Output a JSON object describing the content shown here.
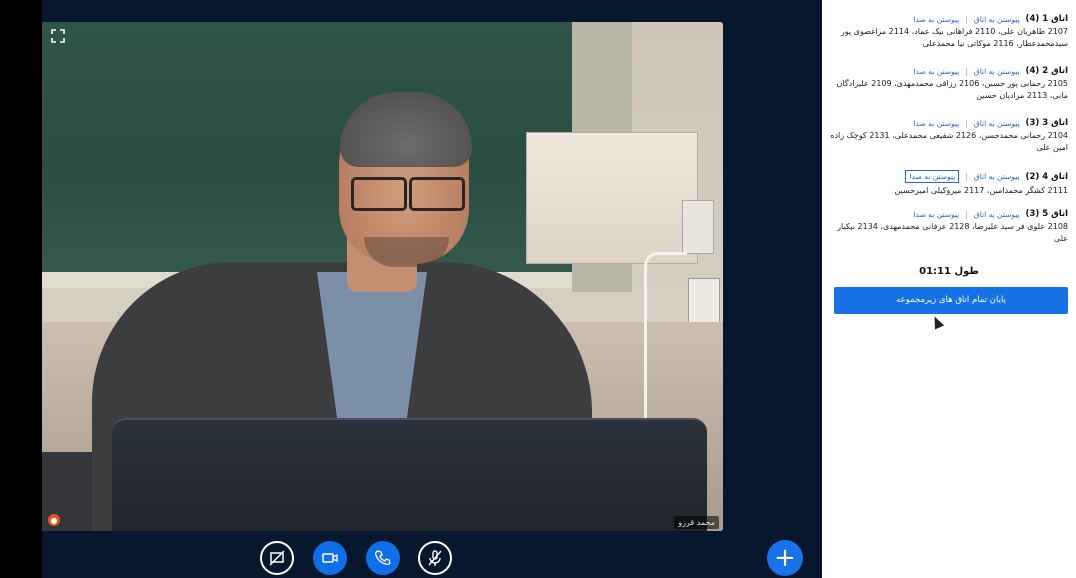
{
  "video": {
    "participant_name": "محمد قرزو",
    "fullscreen_icon": "expand-icon"
  },
  "controls": [
    {
      "name": "screen-share-off-button",
      "icon": "screen-off-icon"
    },
    {
      "name": "camera-button",
      "icon": "video-camera-icon"
    },
    {
      "name": "phone-button",
      "icon": "phone-icon"
    },
    {
      "name": "mic-off-button",
      "icon": "mic-off-icon"
    }
  ],
  "plus_label": "+",
  "rooms": [
    {
      "title": "اتاق 1 (4)",
      "join": "پیوستن به اتاق",
      "audio": "پیوستن به صدا",
      "members": "2107 طاهریان علی، 2110 فراهانی نیک عماد، 2114 مراغصوی پور سیدمحمدعطار، 2116 موکاتی نیا محمدعلی"
    },
    {
      "title": "اتاق 2 (4)",
      "join": "پیوستن به اتاق",
      "audio": "پیوستن به صدا",
      "members": "2105 رحمانی پور حسین، 2106 رزاقی محمدمهدی، 2109 علیزادگان مانی، 2113 مرادیان حسین"
    },
    {
      "title": "اتاق 3 (3)",
      "join": "پیوستن به اتاق",
      "audio": "پیوستن به صدا",
      "members": "2104 رحمانی محمدحسن، 2126 شفیعی محمدعلی، 2131 کوچک زاده امین علی"
    },
    {
      "title": "اتاق 4 (2)",
      "join": "پیوستن به اتاق",
      "audio": "پیوستن به صدا",
      "members": "2111 کشگر محمدامین، 2117 میروکیلی امیرحسین"
    },
    {
      "title": "اتاق 5 (3)",
      "join": "پیوستن به اتاق",
      "audio": "پیوستن به صدا",
      "members": "2108 علوی فر سید علیرضا، 2128 عرفانی محمدمهدی، 2134 نیکیار علی"
    }
  ],
  "timer": "طول 01:11",
  "end_button": "پایان تمام اتاق های زیرمجموعه",
  "colors": {
    "accent": "#1671e5",
    "background": "#06172e"
  }
}
